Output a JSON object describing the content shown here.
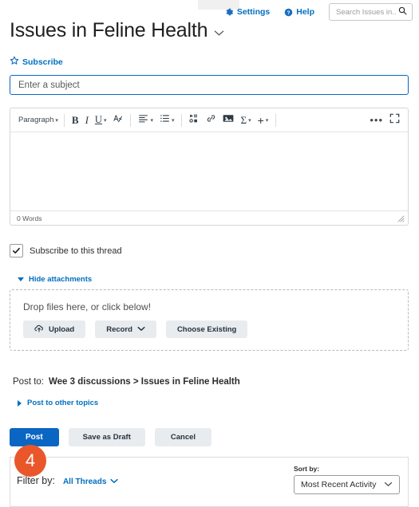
{
  "topbar": {
    "settings_label": "Settings",
    "help_label": "Help",
    "search_placeholder": "Search Issues in...",
    "search_value": ""
  },
  "header": {
    "title": "Issues in Feline Health",
    "subscribe_label": "Subscribe"
  },
  "subject": {
    "placeholder": "Enter a subject",
    "value": ""
  },
  "editor": {
    "toolbar": {
      "paragraph_label": "Paragraph",
      "bold_label": "B",
      "italic_label": "I",
      "underline_label": "U",
      "clear_format_label": "A",
      "sigma_label": "Σ",
      "plus_label": "+",
      "more_label": "•••"
    },
    "body_text": "",
    "word_count": "0 Words"
  },
  "subscribe_thread": {
    "label": "Subscribe to this thread",
    "checked": true,
    "check_glyph": "✔"
  },
  "attachments": {
    "toggle_label": "Hide attachments",
    "drop_text": "Drop files here, or click below!",
    "upload_label": "Upload",
    "record_label": "Record",
    "choose_existing_label": "Choose Existing"
  },
  "post_to": {
    "label": "Post to:",
    "path": "Wee 3 discussions > Issues in Feline Health",
    "other_topics_label": "Post to other topics"
  },
  "actions": {
    "post_label": "Post",
    "save_draft_label": "Save as Draft",
    "cancel_label": "Cancel"
  },
  "step_badge": {
    "number": "4"
  },
  "filter_bar": {
    "filter_label": "Filter by:",
    "filter_value": "All Threads",
    "sort_label": "Sort by:",
    "sort_value": "Most Recent Activity"
  },
  "colors": {
    "accent_blue": "#006fbf",
    "primary_button": "#0a66c2",
    "badge_orange": "#e8562a",
    "grey_button": "#e8ecef"
  }
}
